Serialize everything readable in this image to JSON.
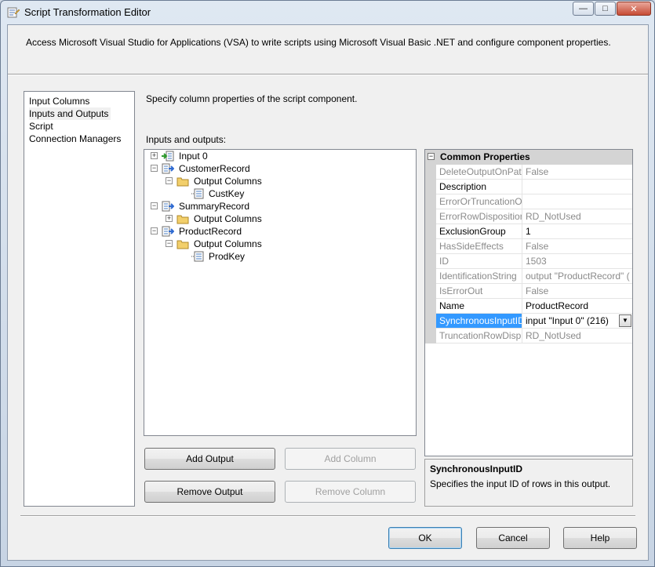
{
  "window": {
    "title": "Script Transformation Editor",
    "controls": {
      "minimize": "—",
      "maximize": "□",
      "close": "✕"
    }
  },
  "description": "Access Microsoft Visual Studio for Applications (VSA) to write scripts using Microsoft Visual Basic .NET and configure component properties.",
  "nav": {
    "items": [
      {
        "label": "Input Columns",
        "selected": false
      },
      {
        "label": "Inputs and Outputs",
        "selected": true
      },
      {
        "label": "Script",
        "selected": false
      },
      {
        "label": "Connection Managers",
        "selected": false
      }
    ]
  },
  "main": {
    "subtitle": "Specify column properties of the script component.",
    "io_label": "Inputs and outputs:"
  },
  "tree": {
    "nodes": [
      {
        "label": "Input 0",
        "icon": "input-icon",
        "expander": "+"
      },
      {
        "label": "CustomerRecord",
        "icon": "output-icon",
        "expander": "−"
      },
      {
        "label": "Output Columns",
        "icon": "folder-icon",
        "expander": "−"
      },
      {
        "label": "CustKey",
        "icon": "column-icon",
        "expander": ""
      },
      {
        "label": "SummaryRecord",
        "icon": "output-icon",
        "expander": "−"
      },
      {
        "label": "Output Columns",
        "icon": "folder-icon",
        "expander": "+"
      },
      {
        "label": "ProductRecord",
        "icon": "output-icon",
        "expander": "−"
      },
      {
        "label": "Output Columns",
        "icon": "folder-icon",
        "expander": "−"
      },
      {
        "label": "ProdKey",
        "icon": "column-icon",
        "expander": ""
      }
    ]
  },
  "properties": {
    "category": "Common Properties",
    "category_expander": "−",
    "rows": [
      {
        "name": "DeleteOutputOnPat",
        "value": "False",
        "readonly": true
      },
      {
        "name": "Description",
        "value": "",
        "readonly": false
      },
      {
        "name": "ErrorOrTruncationO",
        "value": "",
        "readonly": true
      },
      {
        "name": "ErrorRowDispositior",
        "value": "RD_NotUsed",
        "readonly": true
      },
      {
        "name": "ExclusionGroup",
        "value": "1",
        "readonly": false
      },
      {
        "name": "HasSideEffects",
        "value": "False",
        "readonly": true
      },
      {
        "name": "ID",
        "value": "1503",
        "readonly": true
      },
      {
        "name": "IdentificationString",
        "value": "output \"ProductRecord\" (",
        "readonly": true
      },
      {
        "name": "IsErrorOut",
        "value": "False",
        "readonly": true
      },
      {
        "name": "Name",
        "value": "ProductRecord",
        "readonly": false
      },
      {
        "name": "SynchronousInputID",
        "value": "input \"Input 0\" (216)",
        "readonly": false,
        "selected": true
      },
      {
        "name": "TruncationRowDisp",
        "value": "RD_NotUsed",
        "readonly": true
      }
    ]
  },
  "help": {
    "title": "SynchronousInputID",
    "text": "Specifies the input ID of rows in this output."
  },
  "buttons": {
    "add_output": "Add Output",
    "add_column": "Add Column",
    "remove_output": "Remove Output",
    "remove_column": "Remove Column",
    "ok": "OK",
    "cancel": "Cancel",
    "help": "Help"
  }
}
